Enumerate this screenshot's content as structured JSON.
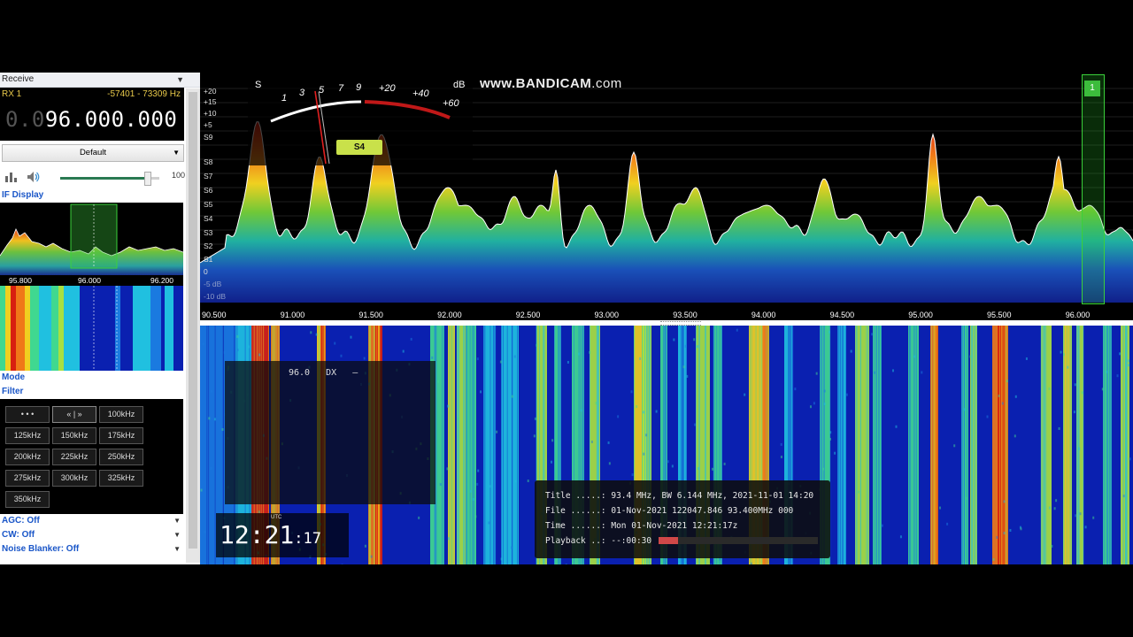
{
  "left_panel": {
    "receive_title": "Receive",
    "rx_label": "RX 1",
    "rx_range": "-57401 - 73309 Hz",
    "freq_dim": "0.0",
    "freq_main": "96.000.000",
    "preset": "Default",
    "volume_label": "100",
    "volume_level": 0.9,
    "if_display_title": "IF Display",
    "if_scale": [
      "95.800",
      "96.000",
      "96.200"
    ],
    "mode_title": "Mode",
    "filter_title": "Filter",
    "filters": [
      "• • •",
      "« | »",
      "100kHz",
      "125kHz",
      "150kHz",
      "175kHz",
      "200kHz",
      "225kHz",
      "250kHz",
      "275kHz",
      "300kHz",
      "325kHz",
      "350kHz"
    ],
    "agc": "AGC: Off",
    "cw": "CW: Off",
    "noise_blanker": "Noise Blanker: Off"
  },
  "spectrum": {
    "watermark_bold": "www.BANDICAM",
    "watermark_lite": ".com",
    "y_labels": [
      "+20",
      "+15",
      "+10",
      "+5",
      "S9",
      "S8",
      "S7",
      "S6",
      "S5",
      "S4",
      "S3",
      "S2",
      "S1",
      "0",
      "-5 dB",
      "-10 dB"
    ],
    "x_labels": [
      "90.500",
      "91.000",
      "91.500",
      "92.000",
      "92.500",
      "93.000",
      "93.500",
      "94.000",
      "94.500",
      "95.000",
      "95.500",
      "96.000"
    ],
    "channel_marker": "1",
    "smeter": {
      "s_label": "S",
      "db_label": "dB",
      "scale": [
        "1",
        "3",
        "5",
        "7",
        "9",
        "+20",
        "+40",
        "+60"
      ],
      "reading": "S4"
    }
  },
  "waterfall": {
    "rds_text": "96.0   DX   —",
    "utc_label": "UTC",
    "clock_hm": "12:21",
    "clock_s": ":17",
    "info": {
      "title": "Title .....: 93.4 MHz, BW 6.144 MHz, 2021-11-01 14:20",
      "file": "File ......: 01-Nov-2021 122047.846 93.400MHz 000",
      "time": "Time ......: Mon 01-Nov-2021 12:21:17z",
      "playback": "Playback ..: --:00:30",
      "playback_progress": 0.12
    }
  },
  "colors": {
    "accent_gold": "#e8c94a",
    "link_blue": "#1a56c8",
    "smeter_badge": "#c9e14a"
  }
}
